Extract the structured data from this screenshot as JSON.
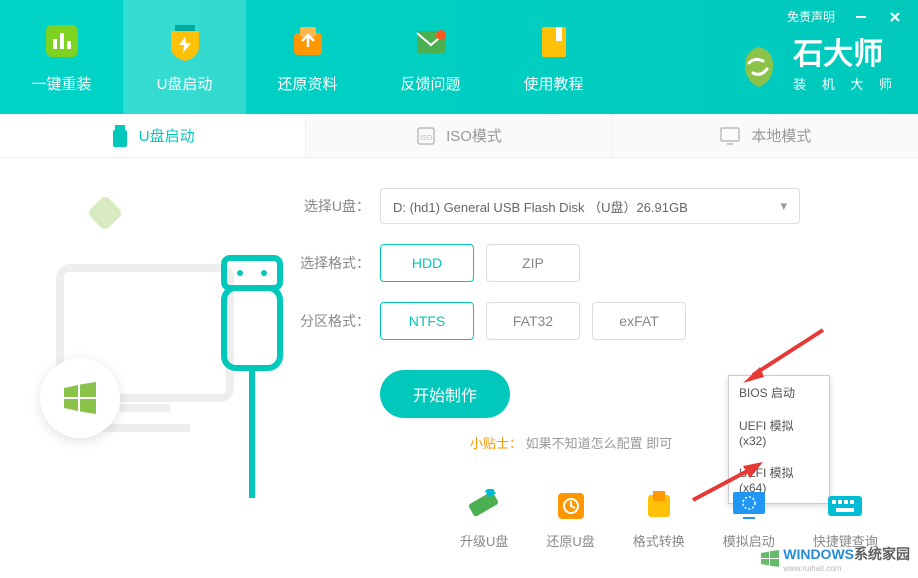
{
  "header": {
    "disclaimer": "免责声明",
    "logo_main": "石大师",
    "logo_sub": "装 机 大 师"
  },
  "nav": [
    {
      "label": "一键重装"
    },
    {
      "label": "U盘启动"
    },
    {
      "label": "还原资料"
    },
    {
      "label": "反馈问题"
    },
    {
      "label": "使用教程"
    }
  ],
  "tabs": [
    {
      "label": "U盘启动"
    },
    {
      "label": "ISO模式"
    },
    {
      "label": "本地模式"
    }
  ],
  "form": {
    "select_disk_label": "选择U盘：",
    "select_disk_value": "D: (hd1) General USB Flash Disk （U盘）26.91GB",
    "format_label": "选择格式：",
    "format_options": [
      "HDD",
      "ZIP"
    ],
    "partition_label": "分区格式：",
    "partition_options": [
      "NTFS",
      "FAT32",
      "exFAT"
    ]
  },
  "start_button": "开始制作",
  "tip": {
    "label": "小贴士：",
    "text": "如果不知道怎么配置                     即可"
  },
  "popup": [
    "BIOS 启动",
    "UEFI 模拟(x32)",
    "UEFI 模拟(x64)"
  ],
  "tools": [
    {
      "label": "升级U盘"
    },
    {
      "label": "还原U盘"
    },
    {
      "label": "格式转换"
    },
    {
      "label": "模拟启动"
    },
    {
      "label": "快捷键查询"
    }
  ],
  "watermark": {
    "text1": "WINDOWS",
    "text2": "系统家园",
    "sub": "www.ruihait.com"
  }
}
